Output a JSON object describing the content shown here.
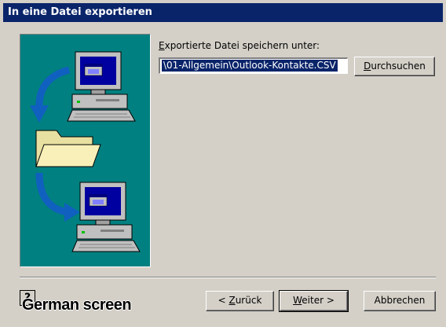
{
  "window": {
    "title": "In eine Datei exportieren"
  },
  "export": {
    "label_first": "E",
    "label_rest": "xportierte Datei speichern unter:",
    "path_value": "\\01-Allgemein\\Outlook-Kontakte.CSV",
    "browse_first": "D",
    "browse_rest": "urchsuchen"
  },
  "buttons": {
    "back_prefix": "< ",
    "back_first": "Z",
    "back_rest": "urück",
    "next_first": "W",
    "next_rest": "eiter >",
    "cancel": "Abbrechen"
  },
  "help": {
    "glyph": "?"
  },
  "overlay": {
    "caption": "German screen"
  },
  "colors": {
    "dialog_bg": "#d4d0c8",
    "titlebar": "#0a246a",
    "illustration_bg": "#008080",
    "selection": "#0a246a"
  },
  "icons": [
    "computer-icon",
    "folder-icon",
    "arrow-icon"
  ]
}
